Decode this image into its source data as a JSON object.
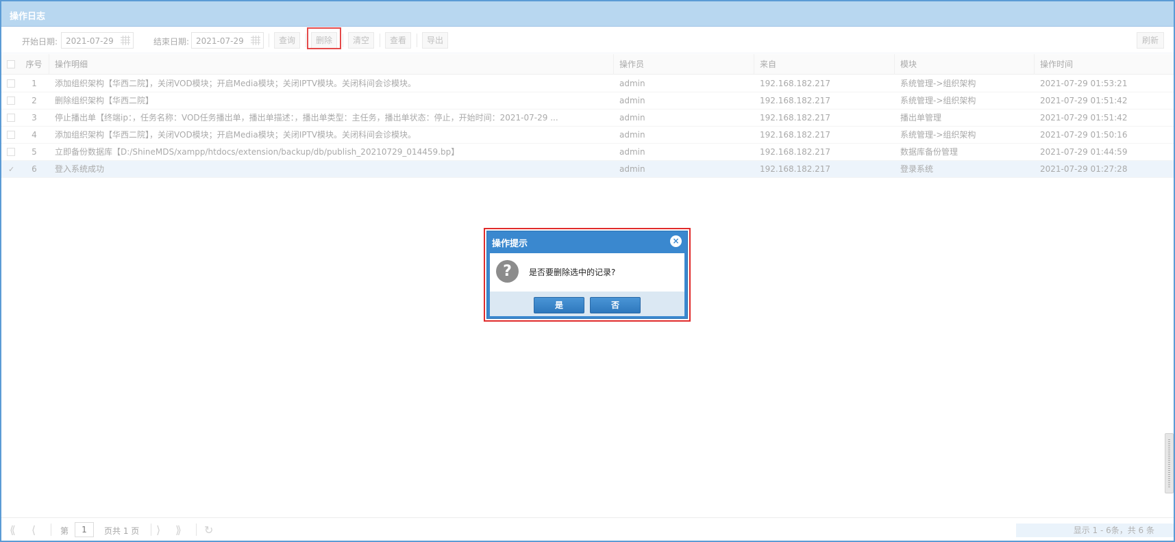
{
  "panel": {
    "title": "操作日志"
  },
  "toolbar": {
    "start_label": "开始日期:",
    "start_value": "2021-07-29",
    "end_label": "结束日期:",
    "end_value": "2021-07-29",
    "buttons": {
      "query": "查询",
      "delete": "删除",
      "clear": "清空",
      "view": "查看",
      "export": "导出",
      "refresh": "刷新"
    }
  },
  "grid": {
    "columns": [
      "序号",
      "操作明细",
      "操作员",
      "来自",
      "模块",
      "操作时间"
    ],
    "rows": [
      {
        "no": "1",
        "detail": "添加组织架构【华西二院】，关闭VOD模块；开启Media模块；关闭IPTV模块。关闭科间会诊模块。",
        "operator": "admin",
        "from": "192.168.182.217",
        "module": "系统管理->组织架构",
        "time": "2021-07-29 01:53:21",
        "selected": false
      },
      {
        "no": "2",
        "detail": "删除组织架构【华西二院】",
        "operator": "admin",
        "from": "192.168.182.217",
        "module": "系统管理->组织架构",
        "time": "2021-07-29 01:51:42",
        "selected": false
      },
      {
        "no": "3",
        "detail": "停止播出单【终端ip：，任务名称：VOD任务播出单，播出单描述：，播出单类型：主任务，播出单状态：停止，开始时间：2021-07-29 ...",
        "operator": "admin",
        "from": "192.168.182.217",
        "module": "播出单管理",
        "time": "2021-07-29 01:51:42",
        "selected": false
      },
      {
        "no": "4",
        "detail": "添加组织架构【华西二院】，关闭VOD模块；开启Media模块；关闭IPTV模块。关闭科间会诊模块。",
        "operator": "admin",
        "from": "192.168.182.217",
        "module": "系统管理->组织架构",
        "time": "2021-07-29 01:50:16",
        "selected": false
      },
      {
        "no": "5",
        "detail": "立即备份数据库【D:/ShineMDS/xampp/htdocs/extension/backup/db/publish_20210729_014459.bp】",
        "operator": "admin",
        "from": "192.168.182.217",
        "module": "数据库备份管理",
        "time": "2021-07-29 01:44:59",
        "selected": false
      },
      {
        "no": "6",
        "detail": "登入系统成功",
        "operator": "admin",
        "from": "192.168.182.217",
        "module": "登录系统",
        "time": "2021-07-29 01:27:28",
        "selected": true
      }
    ]
  },
  "dialog": {
    "title": "操作提示",
    "message": "是否要删除选中的记录?",
    "yes": "是",
    "no": "否",
    "close_glyph": "×",
    "icon_glyph": "?"
  },
  "pager": {
    "page_prefix": "第",
    "page_value": "1",
    "page_suffix": "页共 1 页",
    "info": "显示 1 - 6条，共 6 条"
  },
  "colors": {
    "header": "#b8d7f0",
    "dialog": "#3a88cf",
    "highlight": "#e02a2a",
    "selected_row": "#eaf3fb"
  },
  "icons": {
    "date_picker": "calendar-icon",
    "dialog": "question-icon",
    "close": "close-icon",
    "pager_first": "first-page-icon",
    "pager_prev": "prev-page-icon",
    "pager_next": "next-page-icon",
    "pager_last": "last-page-icon",
    "pager_reload": "reload-icon"
  }
}
